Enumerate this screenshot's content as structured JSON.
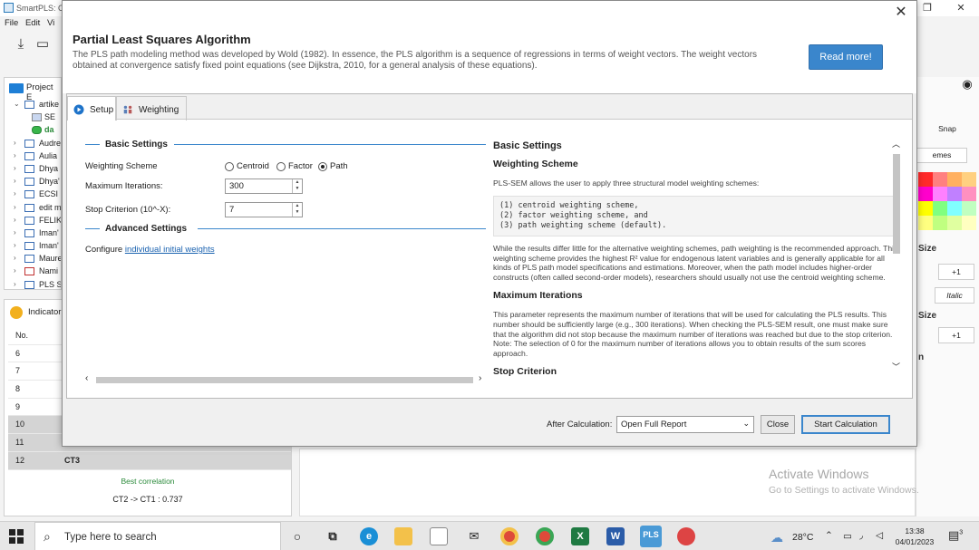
{
  "app": {
    "title": "SmartPLS: C",
    "menu": [
      "File",
      "Edit",
      "Vi"
    ],
    "window_controls": {
      "minimize": "—",
      "restore": "❐",
      "close": "✕"
    }
  },
  "project_explorer": {
    "title": "Project E",
    "items": [
      {
        "label": "artike",
        "expanded": true
      },
      {
        "label": "SE",
        "type": "model"
      },
      {
        "label": "da",
        "type": "data"
      },
      {
        "label": "Audre"
      },
      {
        "label": "Aulia"
      },
      {
        "label": "Dhya"
      },
      {
        "label": "Dhya'"
      },
      {
        "label": "ECSI"
      },
      {
        "label": "edit m"
      },
      {
        "label": "FELIKS"
      },
      {
        "label": "Iman'"
      },
      {
        "label": "Iman'"
      },
      {
        "label": "Maure"
      },
      {
        "label": "Nami"
      },
      {
        "label": "PLS S"
      }
    ]
  },
  "indicator_panel": {
    "title": "Indicator",
    "column_header": "No.",
    "rows": [
      {
        "no": "6",
        "name": ""
      },
      {
        "no": "7",
        "name": ""
      },
      {
        "no": "8",
        "name": ""
      },
      {
        "no": "9",
        "name": ""
      },
      {
        "no": "10",
        "name": ""
      },
      {
        "no": "11",
        "name": ""
      },
      {
        "no": "12",
        "name": "CT3"
      }
    ],
    "best_correlation_label": "Best correlation",
    "best_correlation_value": "CT2 -> CT1 : 0.737"
  },
  "right_panel": {
    "snap_label": "Snap",
    "schemes_label": "emes",
    "size_label_1": "Size",
    "plus_one_1": "+1",
    "italic_label": "Italic",
    "size_label_2": "Size",
    "plus_one_2": "+1",
    "n_label": "n"
  },
  "watermark": {
    "line1": "Activate Windows",
    "line2": "Go to Settings to activate Windows."
  },
  "dialog": {
    "title": "Partial Least Squares Algorithm",
    "description": "The PLS path modeling method was developed by Wold (1982). In essence, the PLS algorithm is a sequence of regressions in terms of weight vectors. The weight vectors obtained at convergence satisfy fixed point equations (see Dijkstra, 2010, for a general analysis of these equations).",
    "read_more": "Read more!",
    "close_glyph": "✕",
    "tabs": [
      {
        "label": "Setup",
        "active": true
      },
      {
        "label": "Weighting",
        "active": false
      }
    ],
    "basic_settings": {
      "title": "Basic Settings",
      "weighting_scheme_label": "Weighting Scheme",
      "weighting_options": [
        "Centroid",
        "Factor",
        "Path"
      ],
      "selected_option": "Path",
      "max_iter_label": "Maximum Iterations:",
      "max_iter_value": "300",
      "stop_label": "Stop Criterion (10^-X):",
      "stop_value": "7"
    },
    "advanced_settings": {
      "title": "Advanced Settings",
      "configure_text": "Configure ",
      "configure_link": "individual initial weights"
    },
    "help": {
      "h1": "Basic Settings",
      "h2_weighting": "Weighting Scheme",
      "p_intro": "PLS-SEM allows the user to apply three structural model weighting schemes:",
      "code": "(1) centroid weighting scheme,\n(2) factor weighting scheme, and\n(3) path weighting scheme (default).",
      "p_weighting": "While the results differ little for the alternative weighting schemes, path weighting is the recommended approach. This weighting scheme provides the highest R² value for endogenous latent variables and is generally applicable for all kinds of PLS path model specifications and estimations. Moreover, when the path model includes higher-order constructs (often called second-order models), researchers should usually not use the centroid weighting scheme.",
      "h2_max_iter": "Maximum Iterations",
      "p_max_iter": "This parameter represents the maximum number of iterations that will be used for calculating the PLS results. This number should be sufficiently large (e.g., 300 iterations). When checking the PLS-SEM result, one must make sure that the algorithm did not stop because the maximum number of iterations was reached but due to the stop criterion. Note: The selection of 0 for the maximum number of iterations allows you to obtain results of the sum scores approach.",
      "h2_stop": "Stop Criterion"
    },
    "footer": {
      "after_calc_label": "After Calculation:",
      "after_calc_value": "Open Full Report",
      "close_label": "Close",
      "start_label": "Start Calculation"
    }
  },
  "taskbar": {
    "search_placeholder": "Type here to search",
    "weather": "28°C",
    "time": "13:38",
    "date": "04/01/2023",
    "notifications": "3",
    "apps": [
      "cortana",
      "task-view",
      "edge",
      "file-explorer",
      "store",
      "mail",
      "chrome",
      "chrome-2",
      "excel",
      "word",
      "smartpls",
      "pdf"
    ]
  }
}
